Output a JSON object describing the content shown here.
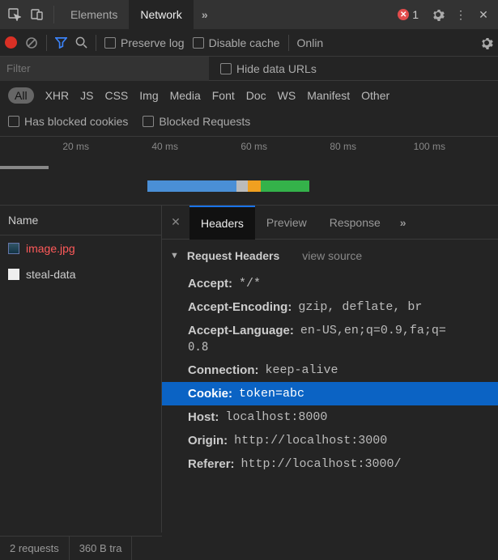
{
  "top": {
    "tab_elements": "Elements",
    "tab_network": "Network",
    "error_count": "1"
  },
  "toolbar": {
    "preserve_log": "Preserve log",
    "disable_cache": "Disable cache",
    "throttle": "Onlin"
  },
  "filter": {
    "placeholder": "Filter",
    "hide_data_urls": "Hide data URLs"
  },
  "types": {
    "all": "All",
    "items": [
      "XHR",
      "JS",
      "CSS",
      "Img",
      "Media",
      "Font",
      "Doc",
      "WS",
      "Manifest",
      "Other"
    ]
  },
  "block": {
    "has_blocked": "Has blocked cookies",
    "blocked_req": "Blocked Requests"
  },
  "timeline": {
    "ticks": [
      "20 ms",
      "40 ms",
      "60 ms",
      "80 ms",
      "100 ms"
    ]
  },
  "left": {
    "name_header": "Name",
    "req1": "image.jpg",
    "req2": "steal-data"
  },
  "right": {
    "tabs": {
      "headers": "Headers",
      "preview": "Preview",
      "response": "Response"
    },
    "section": "Request Headers",
    "view_source": "view source",
    "headers": {
      "accept_k": "Accept:",
      "accept_v": "*/*",
      "ae_k": "Accept-Encoding:",
      "ae_v": "gzip, deflate, br",
      "al_k": "Accept-Language:",
      "al_v": "en-US,en;q=0.9,fa;q=",
      "al_v2": "0.8",
      "conn_k": "Connection:",
      "conn_v": "keep-alive",
      "cookie_k": "Cookie:",
      "cookie_v": "token=abc",
      "host_k": "Host:",
      "host_v": "localhost:8000",
      "origin_k": "Origin:",
      "origin_v": "http://localhost:3000",
      "ref_k": "Referer:",
      "ref_v": "http://localhost:3000/"
    }
  },
  "status": {
    "requests": "2 requests",
    "transferred": "360 B tra"
  }
}
